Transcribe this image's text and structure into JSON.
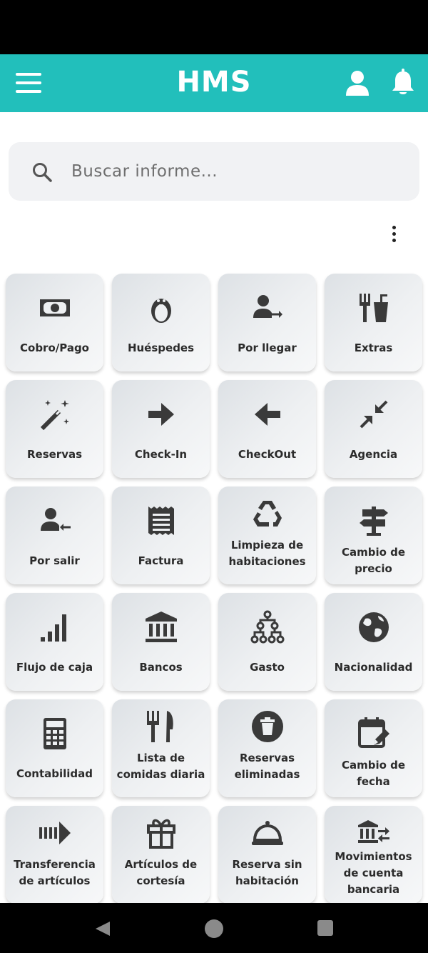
{
  "app": {
    "brand": "HMS"
  },
  "header": {
    "menu_icon": "menu-icon",
    "user_icon": "user-icon",
    "bell_icon": "bell-icon"
  },
  "search": {
    "placeholder": "Buscar informe..."
  },
  "tiles": [
    {
      "label": "Cobro/Pago",
      "icon": "money-icon"
    },
    {
      "label": "Huéspedes",
      "icon": "penguin-icon"
    },
    {
      "label": "Por llegar",
      "icon": "user-arrow-in-icon"
    },
    {
      "label": "Extras",
      "icon": "fork-drink-icon"
    },
    {
      "label": "Reservas",
      "icon": "magic-wand-icon"
    },
    {
      "label": "Check-In",
      "icon": "arrow-right-icon"
    },
    {
      "label": "CheckOut",
      "icon": "arrow-left-icon"
    },
    {
      "label": "Agencia",
      "icon": "compress-icon"
    },
    {
      "label": "Por salir",
      "icon": "user-arrow-out-icon"
    },
    {
      "label": "Factura",
      "icon": "receipt-icon"
    },
    {
      "label": "Limpieza de habitaciones",
      "icon": "recycle-icon"
    },
    {
      "label": "Cambio de precio",
      "icon": "signpost-icon"
    },
    {
      "label": "Flujo de caja",
      "icon": "signal-bars-icon"
    },
    {
      "label": "Bancos",
      "icon": "bank-icon"
    },
    {
      "label": "Gasto",
      "icon": "hierarchy-icon"
    },
    {
      "label": "Nacionalidad",
      "icon": "globe-icon"
    },
    {
      "label": "Contabilidad",
      "icon": "calculator-icon"
    },
    {
      "label": "Lista de comidas diaria",
      "icon": "utensils-icon"
    },
    {
      "label": "Reservas eliminadas",
      "icon": "trash-circle-icon"
    },
    {
      "label": "Cambio de fecha",
      "icon": "calendar-edit-icon"
    },
    {
      "label": "Transferencia de artículos",
      "icon": "fast-forward-icon"
    },
    {
      "label": "Artículos de cortesía",
      "icon": "gift-icon"
    },
    {
      "label": "Reserva sin habitación",
      "icon": "cloche-icon"
    },
    {
      "label": "Movimientos de cuenta bancaria",
      "icon": "bank-transfer-icon"
    }
  ],
  "colors": {
    "appbar": "#22bfbb",
    "icon": "#3a3a3a",
    "tile_text": "#2b2b2b"
  }
}
